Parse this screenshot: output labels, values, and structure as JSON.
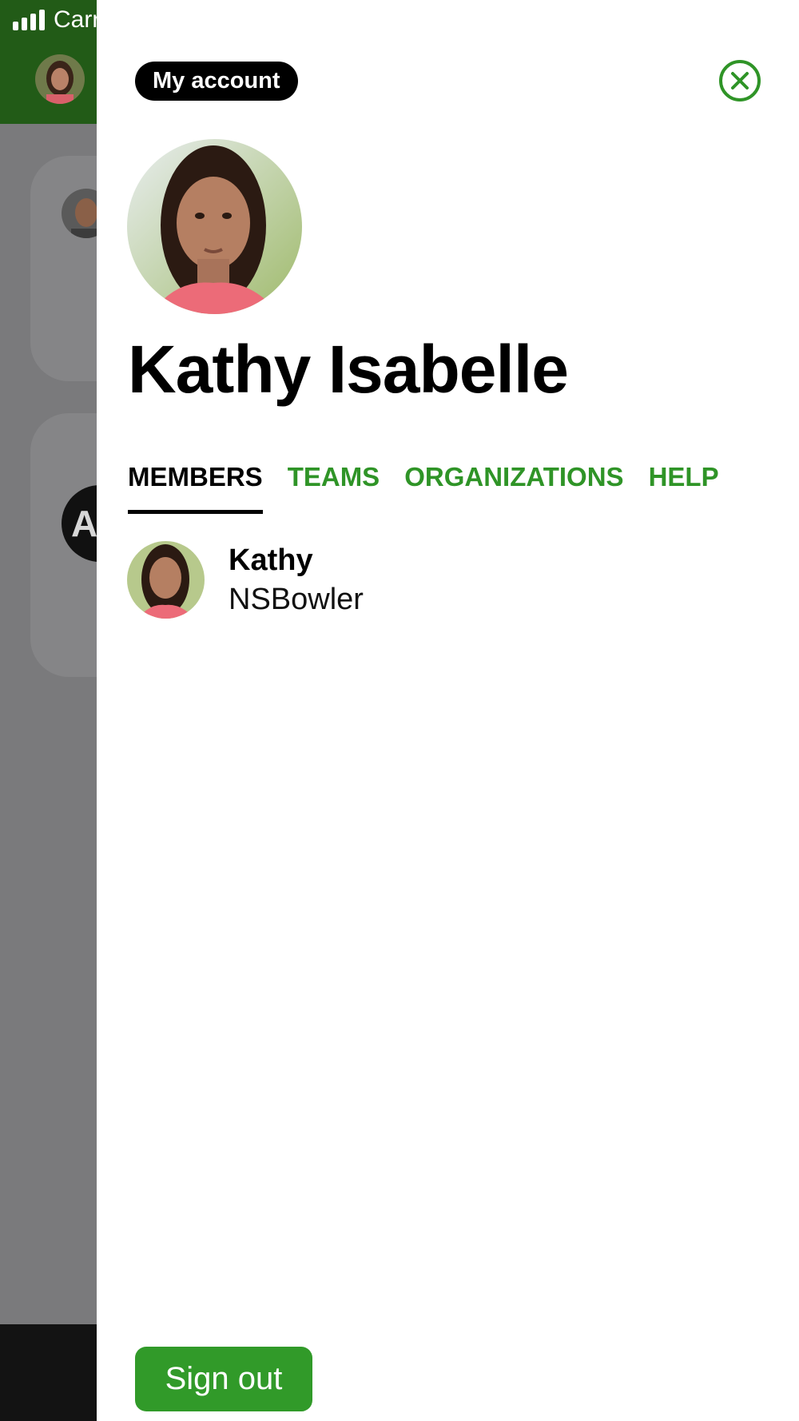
{
  "status_bar": {
    "carrier": "Carr"
  },
  "background": {
    "card_letter": "A"
  },
  "drawer": {
    "account_label": "My account",
    "profile_name": "Kathy Isabelle",
    "tabs": [
      {
        "label": "MEMBERS",
        "active": true
      },
      {
        "label": "TEAMS",
        "active": false
      },
      {
        "label": "ORGANIZATIONS",
        "active": false
      },
      {
        "label": "HELP",
        "active": false
      }
    ],
    "members": [
      {
        "name": "Kathy",
        "subtitle": "NSBowler"
      }
    ],
    "sign_out_label": "Sign out"
  },
  "colors": {
    "accent_green": "#2f9427",
    "header_green": "#225b17",
    "button_green": "#319a29"
  },
  "icons": [
    "signal-icon",
    "close-icon"
  ]
}
